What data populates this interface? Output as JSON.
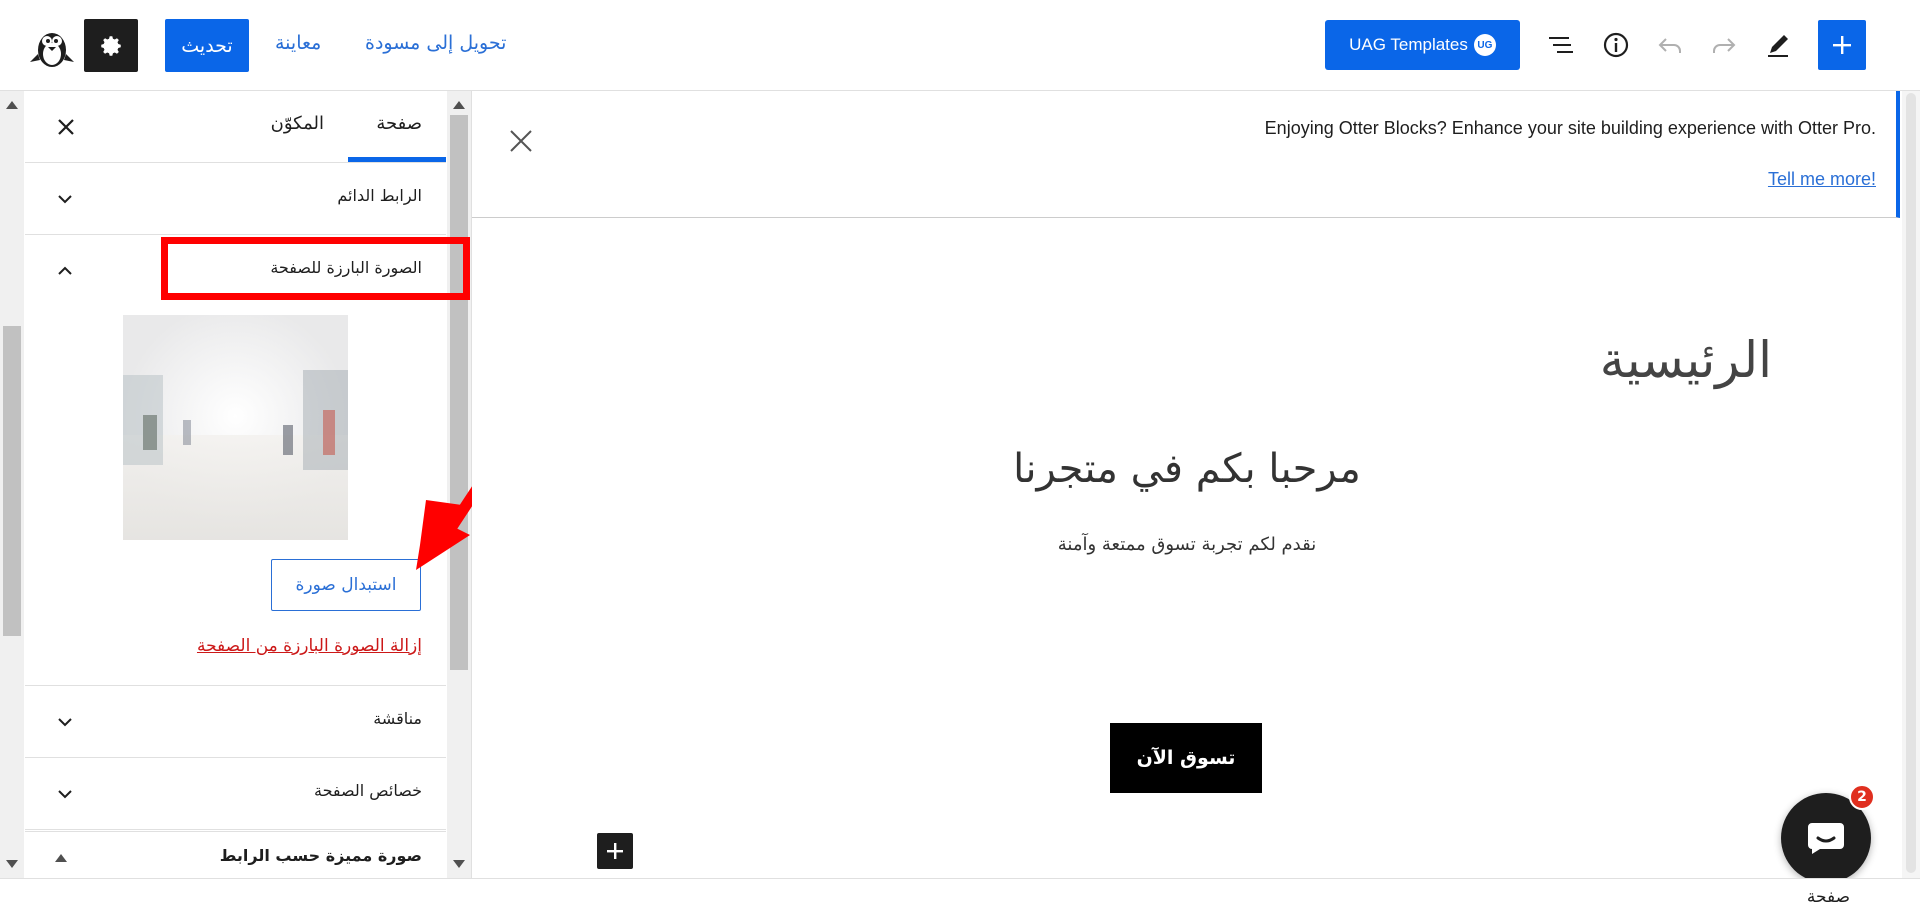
{
  "toolbar": {
    "update_label": "تحديث",
    "preview_label": "معاينة",
    "draft_label": "تحويل إلى مسودة",
    "uag_label": "UAG Templates",
    "uag_badge": "UG"
  },
  "sidebar": {
    "tab_page": "صفحة",
    "tab_block": "المكوّن",
    "panels": {
      "permalink": "الرابط الدائم",
      "featured_image": "الصورة البارزة للصفحة",
      "discussion": "مناقشة",
      "page_attributes": "خصائص الصفحة",
      "featured_by_link": "صورة مميزة حسب الرابط"
    },
    "replace_image": "استبدال صورة",
    "remove_image": "إزالة الصورة البارزة من الصفحة"
  },
  "notice": {
    "text": "Enjoying Otter Blocks? Enhance your site building experience with Otter Pro.",
    "link": "Tell me more!"
  },
  "canvas": {
    "page_title": "الرئيسية",
    "heading": "مرحبا بكم في متجرنا",
    "subtitle": "نقدم لكم تجربة تسوق ممتعة وآمنة",
    "shop_button": "تسوق الآن"
  },
  "chat": {
    "badge": "2"
  },
  "footer": {
    "breadcrumb": "صفحة"
  },
  "colors": {
    "accent": "#0a66e8",
    "annotation": "#ff0000",
    "danger": "#cc1818"
  }
}
